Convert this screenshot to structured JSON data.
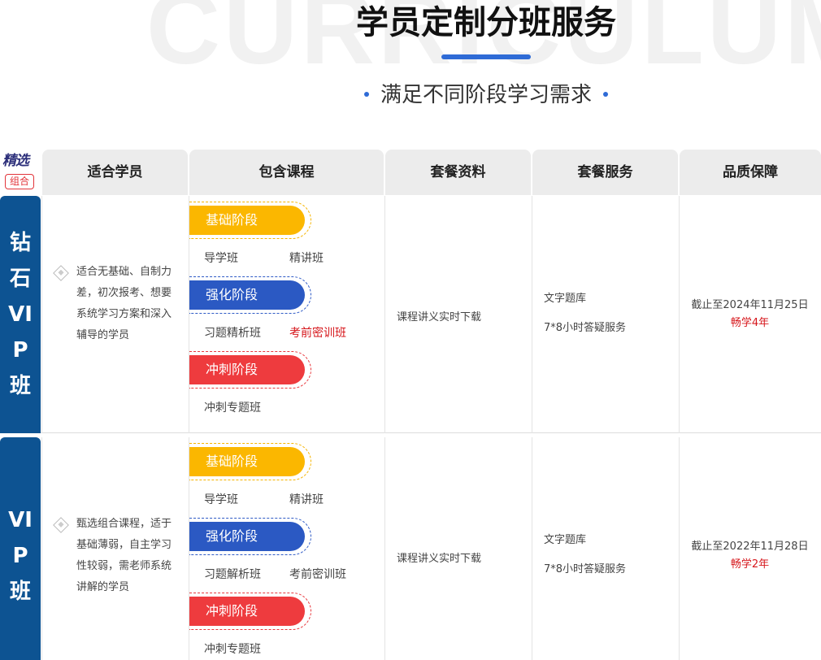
{
  "hero": {
    "bg_word": "CURRICULUM",
    "title": "学员定制分班服务",
    "subtitle": "满足不同阶段学习需求"
  },
  "badge": {
    "line1": "精选",
    "line2": "组合"
  },
  "columns": [
    "适合学员",
    "包含课程",
    "套餐资料",
    "套餐服务",
    "品质保障"
  ],
  "rows": [
    {
      "vip_chars": [
        "钻",
        "石",
        "VI",
        "P",
        "班"
      ],
      "fit_text": "适合无基础、自制力差，初次报考、想要系统学习方案和深入辅导的学员",
      "stages": [
        {
          "label": "基础阶段",
          "color": "#fbb700",
          "courses": [
            {
              "text": "导学班",
              "red": false
            },
            {
              "text": "精讲班",
              "red": false
            }
          ]
        },
        {
          "label": "强化阶段",
          "color": "#2b59c3",
          "courses": [
            {
              "text": "习题精析班",
              "red": false
            },
            {
              "text": "考前密训班",
              "red": true
            }
          ]
        },
        {
          "label": "冲刺阶段",
          "color": "#ee3b3e",
          "courses": [
            {
              "text": "冲刺专题班",
              "red": false
            }
          ]
        }
      ],
      "materials": "课程讲义实时下载",
      "services": [
        "文字题库",
        "7*8小时答疑服务"
      ],
      "quality_date": "截止至2024年11月25日",
      "quality_term": "畅学4年"
    },
    {
      "vip_chars": [
        "VI",
        "P",
        "班"
      ],
      "fit_text": "甄选组合课程，适于基础薄弱，自主学习性较弱，需老师系统讲解的学员",
      "stages": [
        {
          "label": "基础阶段",
          "color": "#fbb700",
          "courses": [
            {
              "text": "导学班",
              "red": false
            },
            {
              "text": "精讲班",
              "red": false
            }
          ]
        },
        {
          "label": "强化阶段",
          "color": "#2b59c3",
          "courses": [
            {
              "text": "习题解析班",
              "red": false
            },
            {
              "text": "考前密训班",
              "red": false
            }
          ]
        },
        {
          "label": "冲刺阶段",
          "color": "#ee3b3e",
          "courses": [
            {
              "text": "冲刺专题班",
              "red": false
            }
          ]
        }
      ],
      "materials": "课程讲义实时下载",
      "services": [
        "文字题库",
        "7*8小时答疑服务"
      ],
      "quality_date": "截止至2022年11月28日",
      "quality_term": "畅学2年"
    }
  ]
}
